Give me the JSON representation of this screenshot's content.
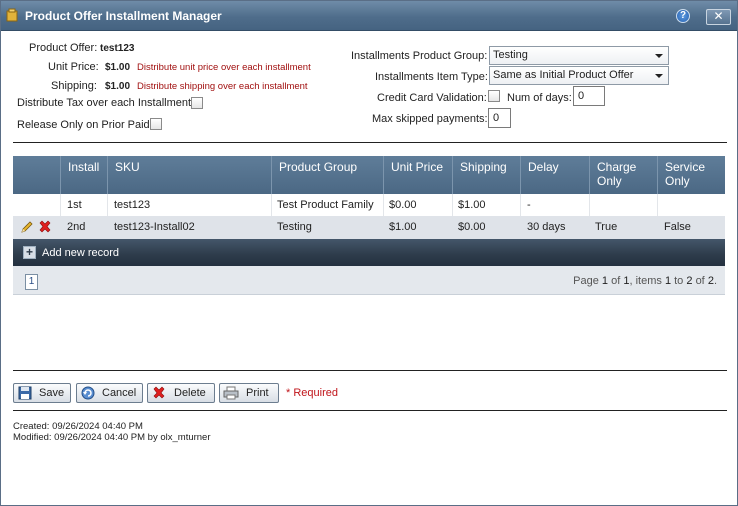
{
  "window": {
    "title": "Product Offer Installment Manager",
    "help": "?",
    "close": "✕"
  },
  "form": {
    "product_offer_label": "Product Offer:",
    "product_offer_value": "test123",
    "unit_price_label": "Unit Price:",
    "unit_price_value": "$1.00",
    "unit_price_note": "Distribute unit price over each installment",
    "shipping_label": "Shipping:",
    "shipping_value": "$1.00",
    "shipping_note": "Distribute shipping over each installment",
    "distribute_tax_label": "Distribute Tax over each Installment:",
    "release_prior_paid_label": "Release Only on Prior Paid:",
    "installments_product_group_label": "Installments Product Group:",
    "installments_product_group_value": "Testing",
    "installments_item_type_label": "Installments Item Type:",
    "installments_item_type_value": "Same as Initial Product Offer",
    "credit_card_validation_label": "Credit Card Validation:",
    "num_days_label": "Num of days:",
    "num_days_value": "0",
    "max_skipped_label": "Max skipped payments:",
    "max_skipped_value": "0"
  },
  "grid": {
    "columns": [
      "Install",
      "SKU",
      "Product Group",
      "Unit Price",
      "Shipping",
      "Delay",
      "Charge Only",
      "Service Only"
    ],
    "rows": [
      {
        "install": "1st",
        "sku": "test123",
        "product_group": "Test Product Family",
        "unit_price": "$0.00",
        "shipping": "$1.00",
        "delay": "-",
        "charge_only": "",
        "service_only": ""
      },
      {
        "install": "2nd",
        "sku": "test123-Install02",
        "product_group": "Testing",
        "unit_price": "$1.00",
        "shipping": "$0.00",
        "delay": "30 days",
        "charge_only": "True",
        "service_only": "False"
      }
    ],
    "add_record": "Add new record",
    "pager": {
      "current_page": "1",
      "page_word": "Page",
      "page": "1",
      "of_word": "of",
      "total_pages": "1",
      "items_word": ", items",
      "from": "1",
      "to_word": "to",
      "to": "2",
      "of2_word": "of",
      "total_items": "2",
      "end": "."
    }
  },
  "buttons": {
    "save": "Save",
    "cancel": "Cancel",
    "delete": "Delete",
    "print": "Print"
  },
  "required_text": "* Required",
  "footer": {
    "created": "Created:  09/26/2024 04:40 PM",
    "modified": "Modified:  09/26/2024 04:40 PM   by olx_mturner"
  },
  "colors": {
    "title_bar": "#4f6d8b",
    "grid_header": "#5f7d99",
    "toolbar": "#2d3b4a",
    "required": "#c0141a",
    "note": "#a11010"
  }
}
